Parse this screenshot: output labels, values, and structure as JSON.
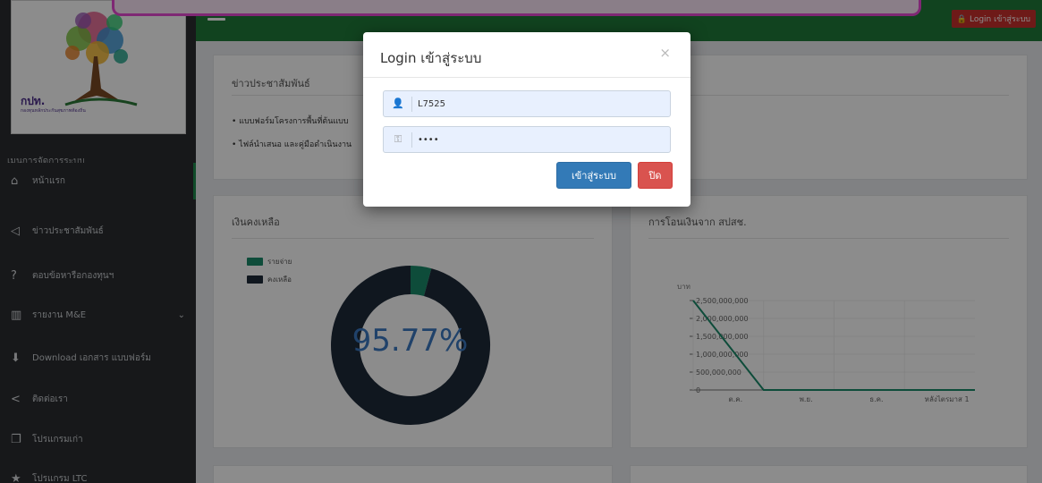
{
  "colors": {
    "topbar": "#1f7a3a",
    "sidebar": "#2a2d31",
    "accent_green": "#1e8b4d",
    "donut_main": "#1e2a3a",
    "donut_expense": "#1b8a6b",
    "percent_text": "#3b78c2",
    "danger": "#d9534f",
    "primary": "#337ab7"
  },
  "topbar": {
    "login_label": "Login เข้าสู่ระบบ"
  },
  "logo": {
    "org_short": "กปท.",
    "org_full": "กองทุนหลักประกันสุขภาพท้องถิ่น"
  },
  "sidebar": {
    "heading": "เมนูการจัดการระบบ",
    "items": [
      {
        "icon": "home-icon",
        "glyph": "⌂",
        "label": "หน้าแรก"
      },
      {
        "icon": "bullhorn-icon",
        "glyph": "📢",
        "label": "ข่าวประชาสัมพันธ์"
      },
      {
        "icon": "question-icon",
        "glyph": "?",
        "label": "ตอบข้อหารือกองทุนฯ"
      },
      {
        "icon": "bar-chart-icon",
        "glyph": "▥",
        "label": "รายงาน M&E"
      },
      {
        "icon": "download-icon",
        "glyph": "⬇",
        "label": "Download เอกสาร แบบฟอร์ม"
      },
      {
        "icon": "share-icon",
        "glyph": "<",
        "label": "ติดต่อเรา"
      },
      {
        "icon": "clone-icon",
        "glyph": "❐",
        "label": "โปรแกรมเก่า"
      },
      {
        "icon": "star-icon",
        "glyph": "★",
        "label": "โปรแกรม LTC"
      }
    ]
  },
  "news": {
    "title": "ข่าวประชาสัมพันธ์",
    "items": [
      "• แบบฟอร์มโครงการพื้นที่ต้นแบบ",
      "• ไฟล์นำเสนอ และคู่มือดำเนินงาน"
    ]
  },
  "balance": {
    "title": "เงินคงเหลือ",
    "legend": [
      "รายจ่าย",
      "คงเหลือ"
    ],
    "percent": "95.77%"
  },
  "transfer": {
    "title": "การโอนเงินจาก สปสช."
  },
  "chart_data": {
    "type": "line",
    "ylabel": "บาท",
    "categories": [
      "ต.ค.",
      "พ.ย.",
      "ธ.ค.",
      "หลังไตรมาส 1"
    ],
    "series": [
      {
        "values": [
          2500000000,
          0,
          0,
          0
        ]
      }
    ],
    "y_ticks": [
      "0",
      "500,000,000",
      "1,000,000,000",
      "1,500,000,000",
      "2,000,000,000",
      "2,500,000,000"
    ],
    "ylim": [
      0,
      2500000000
    ]
  },
  "donut_data": {
    "type": "pie",
    "values": [
      4.23,
      95.77
    ],
    "labels": [
      "รายจ่าย",
      "คงเหลือ"
    ]
  },
  "modal": {
    "title": "Login เข้าสู่ระบบ",
    "close_glyph": "×",
    "username_value": "L7525",
    "password_value": "••••",
    "submit_label": "เข้าสู่ระบบ",
    "cancel_label": "ปิด"
  }
}
